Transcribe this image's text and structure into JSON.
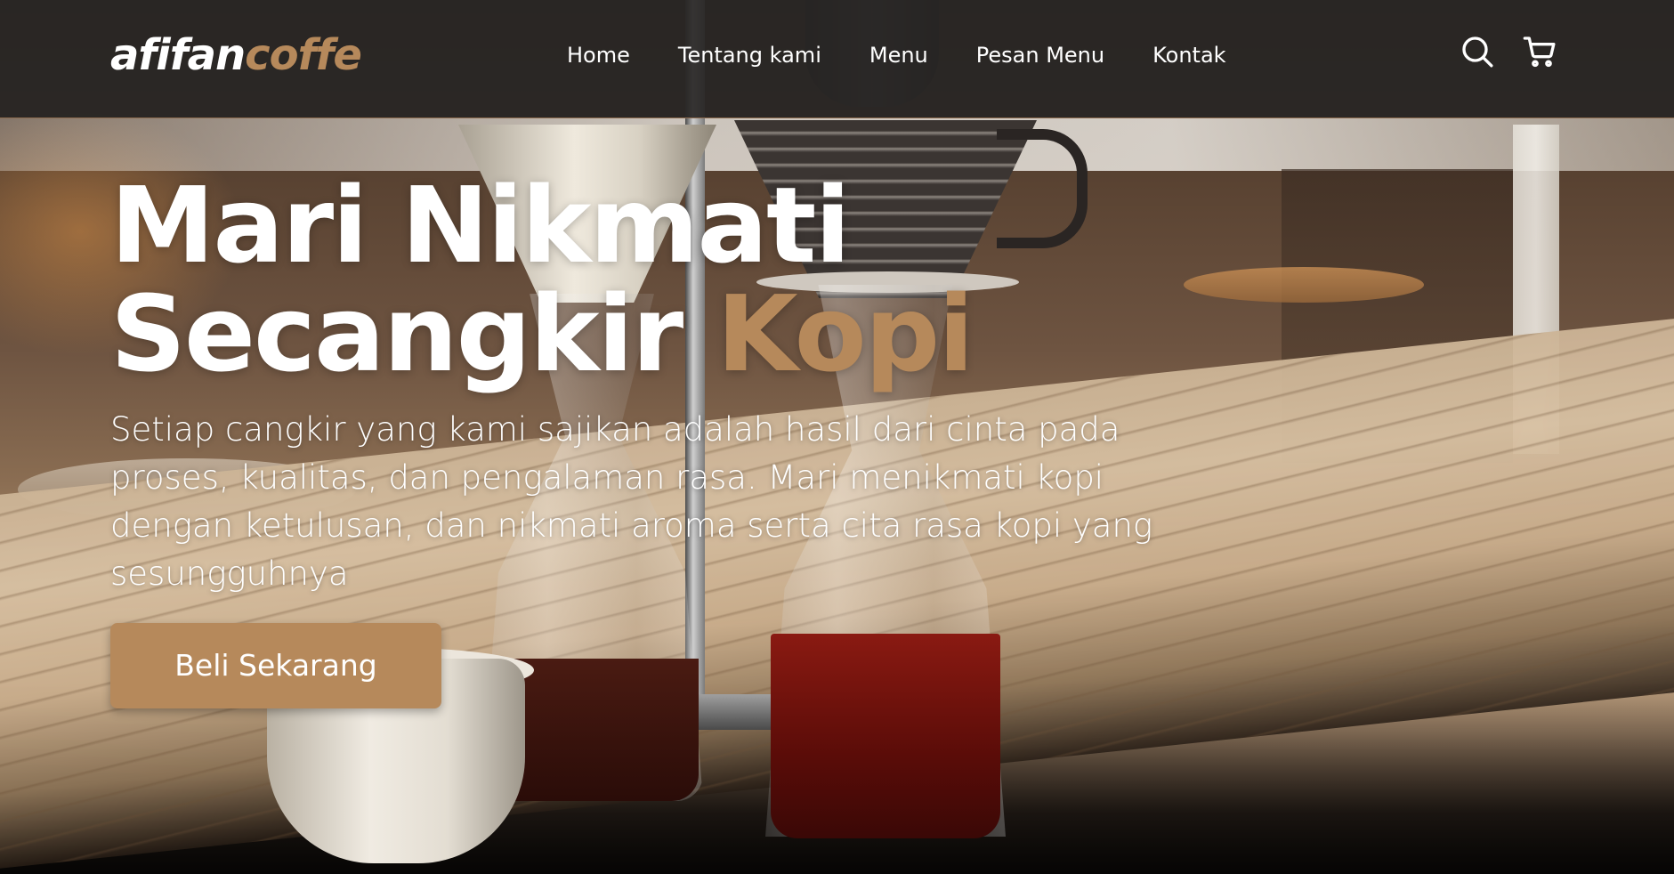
{
  "brand": {
    "logo_part1": "afifan",
    "logo_part2": "coffe"
  },
  "nav": {
    "links": [
      {
        "label": "Home"
      },
      {
        "label": "Tentang kami"
      },
      {
        "label": "Menu"
      },
      {
        "label": "Pesan Menu"
      },
      {
        "label": "Kontak"
      }
    ],
    "icons": [
      "search-icon",
      "cart-icon"
    ]
  },
  "hero": {
    "title_line1": "Mari Nikmati",
    "title_line2_word": "Secangkir",
    "title_line2_accent": "Kopi",
    "description": "Setiap cangkir yang kami sajikan adalah hasil dari cinta pada proses, kualitas, dan pengalaman rasa. Mari menikmati kopi dengan ketulusan, dan nikmati aroma serta cita rasa kopi yang sesungguhnya",
    "cta_label": "Beli Sekarang"
  },
  "colors": {
    "accent": "#b6895b",
    "navbar": "#282625",
    "text": "#ffffff"
  }
}
